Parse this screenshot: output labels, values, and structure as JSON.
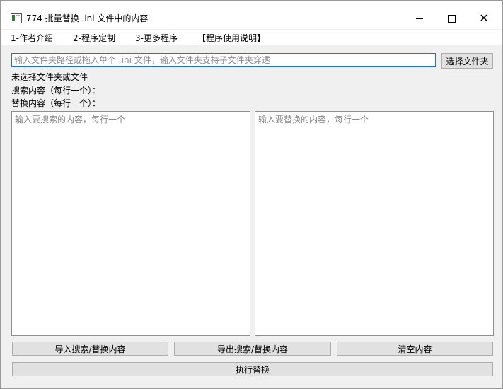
{
  "window": {
    "title": "774 批量替换 .ini 文件中的内容",
    "controls": {
      "minimize": "minimize",
      "maximize": "maximize",
      "close": "✕"
    }
  },
  "menu": {
    "items": [
      {
        "label": "1-作者介绍"
      },
      {
        "label": "2-程序定制"
      },
      {
        "label": "3-更多程序"
      },
      {
        "label": "【程序使用说明】"
      }
    ]
  },
  "path": {
    "value": "",
    "placeholder": "输入文件夹路径或拖入单个 .ini 文件，输入文件夹支持子文件夹穿透",
    "select_button": "选择文件夹"
  },
  "status": {
    "selection": "未选择文件夹或文件"
  },
  "labels": {
    "search": "搜索内容（每行一个）：",
    "replace": "替换内容（每行一个）："
  },
  "search_box": {
    "value": "",
    "placeholder": "输入要搜索的内容，每行一个"
  },
  "replace_box": {
    "value": "",
    "placeholder": "输入要替换的内容，每行一个"
  },
  "buttons": {
    "import": "导入搜索/替换内容",
    "export": "导出搜索/替换内容",
    "clear": "清空内容",
    "execute": "执行替换"
  },
  "icons": {
    "app": "app-window-icon",
    "minimize": "minimize-icon",
    "maximize": "maximize-icon",
    "close": "close-icon"
  },
  "colors": {
    "background": "#f0f0f0",
    "titlebar": "#ffffff",
    "input_focus_border": "#2b6cc4",
    "button_face": "#e1e1e1",
    "button_border": "#adadad",
    "placeholder": "#8a8a8a"
  }
}
